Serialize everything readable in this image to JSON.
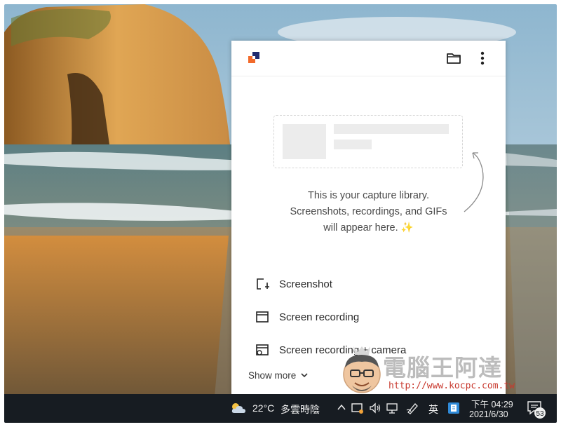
{
  "capture_library": {
    "empty_lines": [
      "This is your capture library.",
      "Screenshots, recordings, and GIFs",
      "will appear here."
    ],
    "sparkle_glyph": "✨",
    "menu": [
      {
        "label": "Screenshot",
        "icon": "screenshot-icon"
      },
      {
        "label": "Screen recording",
        "icon": "screen-recording-icon"
      },
      {
        "label": "Screen recording + camera",
        "icon": "screen-camera-icon"
      }
    ],
    "show_more": "Show more"
  },
  "taskbar": {
    "temperature": "22°C",
    "weather": "多雲時陰",
    "ime": "英",
    "time": "下午 04:29",
    "date": "2021/6/30",
    "notifications": "53"
  },
  "watermark": {
    "title": "電腦王阿達",
    "url": "http://www.kocpc.com.tw"
  },
  "colors": {
    "logo_orange": "#f26a2b",
    "logo_navy": "#1e2a6e",
    "taskbar": "#171c22"
  }
}
